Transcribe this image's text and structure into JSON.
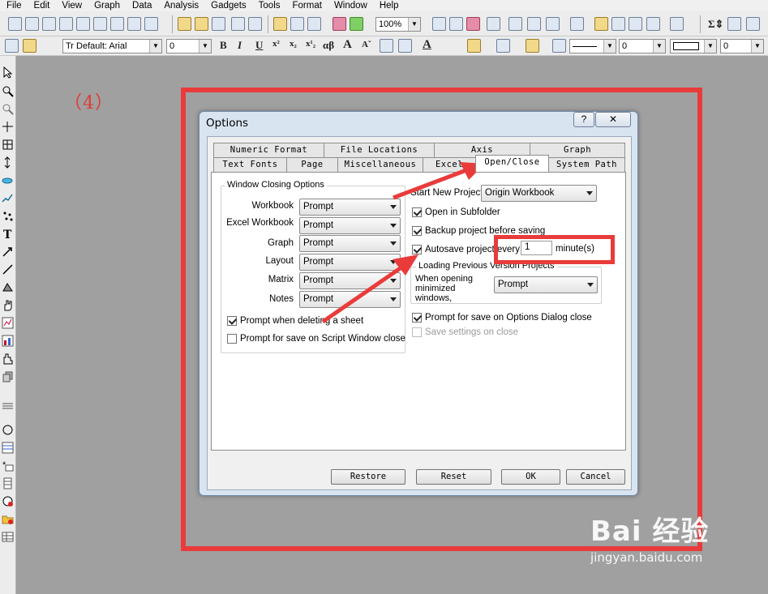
{
  "menubar": [
    "File",
    "Edit",
    "View",
    "Graph",
    "Data",
    "Analysis",
    "Gadgets",
    "Tools",
    "Format",
    "Window",
    "Help"
  ],
  "toolbar": {
    "zoom": "100%",
    "font": "Default: Arial",
    "font_size": "0",
    "bold": "B",
    "italic": "I",
    "underline": "U",
    "greek": "αβ",
    "line_width": "0",
    "border_width": "0"
  },
  "annotation": {
    "step_label": "（4）"
  },
  "dialog": {
    "title": "Options",
    "help_label": "?",
    "close_label": "✕",
    "tabs_row1": [
      "Numeric Format",
      "File Locations",
      "Axis",
      "Graph"
    ],
    "tabs_row2": [
      "Text Fonts",
      "Page",
      "Miscellaneous",
      "Excel",
      "Open/Close",
      "System Path"
    ],
    "window_closing": {
      "title": "Window Closing Options",
      "rows": [
        {
          "label": "Workbook",
          "value": "Prompt"
        },
        {
          "label": "Excel Workbook",
          "value": "Prompt"
        },
        {
          "label": "Graph",
          "value": "Prompt"
        },
        {
          "label": "Layout",
          "value": "Prompt"
        },
        {
          "label": "Matrix",
          "value": "Prompt"
        },
        {
          "label": "Notes",
          "value": "Prompt"
        }
      ],
      "prompt_delete_sheet": "Prompt when deleting a sheet",
      "prompt_save_script": "Prompt for save on Script Window close"
    },
    "start_new_project_label": "Start New Project",
    "start_new_project_value": "Origin Workbook",
    "open_in_subfolder": "Open in Subfolder",
    "backup_before_saving": "Backup project before saving",
    "autosave_label": "Autosave project every",
    "autosave_value": "1",
    "autosave_unit": "minute(s)",
    "loading_previous": {
      "title": "Loading Previous Version Projects",
      "when_opening": "When opening minimized windows,",
      "value": "Prompt"
    },
    "prompt_save_options": "Prompt for save on Options Dialog close",
    "save_settings_on_close": "Save settings on close",
    "buttons": {
      "restore": "Restore",
      "reset": "Reset",
      "ok": "OK",
      "cancel": "Cancel"
    }
  },
  "watermark": {
    "main": "Bai 经验",
    "sub": "jingyan.baidu.com"
  },
  "colors": {
    "annotation_red": "#ea3b3b",
    "dialog_frame": "#d9e4f1"
  }
}
